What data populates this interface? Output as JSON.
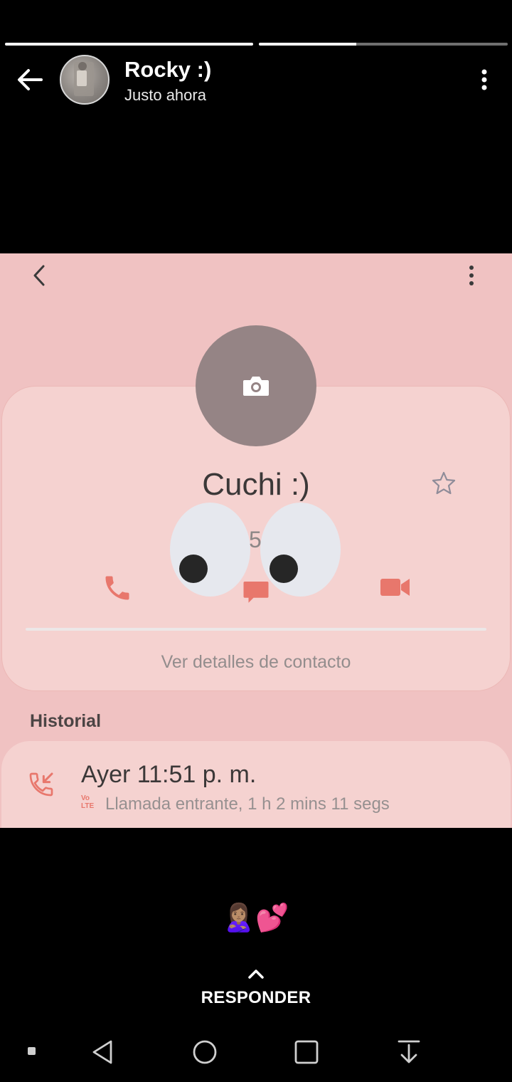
{
  "progress": {
    "segments": [
      1.0,
      0.39
    ]
  },
  "header": {
    "name": "Rocky :)",
    "time": "Justo ahora"
  },
  "story": {
    "contact": {
      "name": "Cuchi :)",
      "number_partial": "5"
    },
    "details_link": "Ver detalles de contacto",
    "history": {
      "label": "Historial",
      "entry": {
        "time": "Ayer 11:51 p. m.",
        "badge_top": "Vo",
        "badge_bottom": "LTE",
        "detail": "Llamada entrante, 1 h 2 mins 11 segs"
      }
    }
  },
  "caption": "🙎🏽‍♀️💕",
  "reply": {
    "label": "RESPONDER"
  },
  "colors": {
    "story_bg": "#f0c2c2",
    "card_bg": "#f5d2d0",
    "accent": "#e8776c"
  }
}
